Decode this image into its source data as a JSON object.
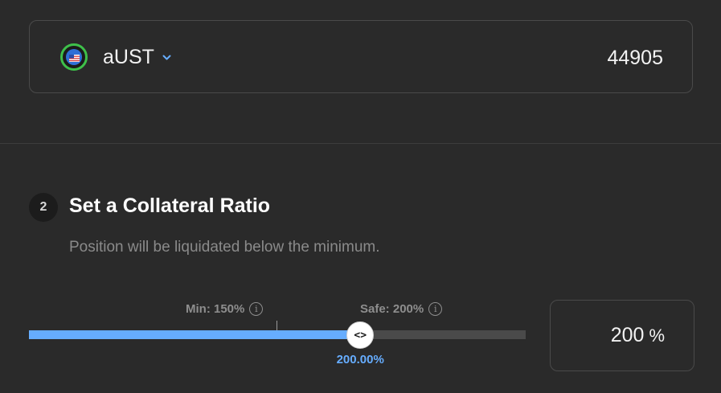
{
  "asset": {
    "token": "aUST",
    "amount": "44905",
    "icon": "ust-flag-token-icon",
    "dropdown_icon": "chevron-down-icon"
  },
  "step": {
    "number": "2",
    "title": "Set a Collateral Ratio",
    "description": "Position will be liquidated below the minimum."
  },
  "slider": {
    "min_label": "Min: 150%",
    "safe_label": "Safe: 200%",
    "current_label": "200.00%",
    "handle_glyph": "<>",
    "info_icon_glyph": "i",
    "fill_fraction": 0.667
  },
  "ratio_input": {
    "value": "200",
    "unit": "%"
  },
  "colors": {
    "accent": "#66adff",
    "token_ring": "#3ec04a",
    "background": "#2a2a2a",
    "track": "#4a4a4a"
  }
}
